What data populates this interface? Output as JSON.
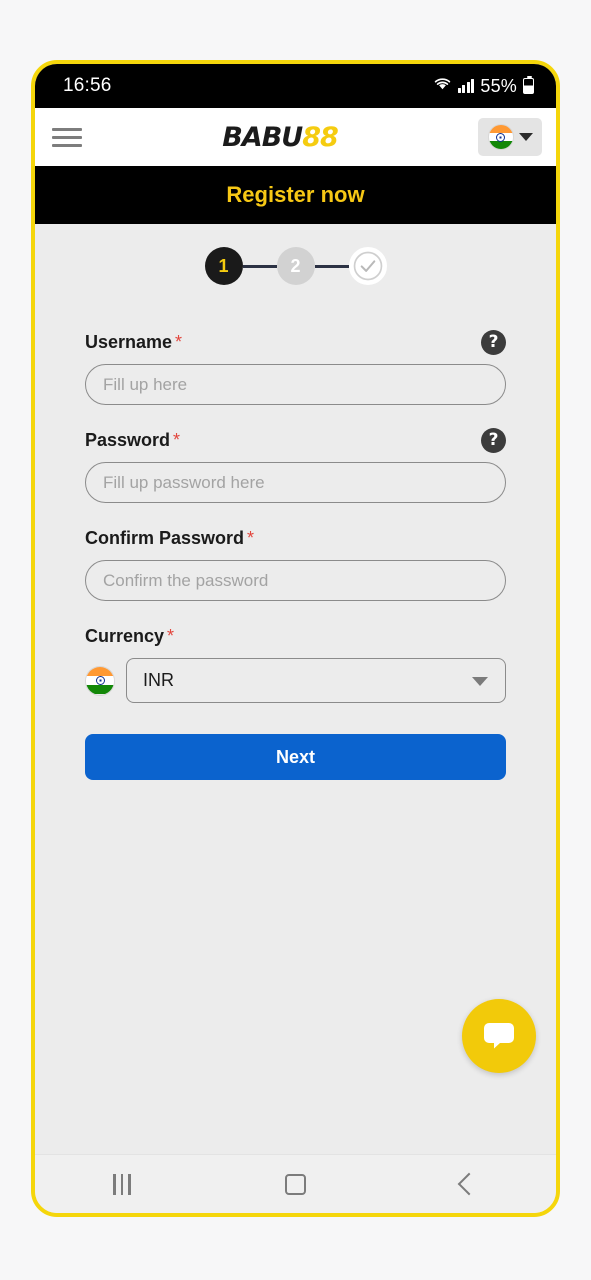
{
  "status_bar": {
    "time": "16:56",
    "battery_text": "55%",
    "wifi_icon": "wifi-icon",
    "signal_icon": "cellular-signal-icon",
    "battery_icon": "battery-icon"
  },
  "header": {
    "menu_icon": "hamburger-menu-icon",
    "logo_part1": "BABU",
    "logo_part2": "88",
    "language_flag": "india-flag-icon",
    "language_caret": "chevron-down-icon"
  },
  "banner": {
    "title": "Register now"
  },
  "stepper": {
    "steps": [
      {
        "label": "1",
        "state": "active"
      },
      {
        "label": "2",
        "state": "idle"
      },
      {
        "label": "",
        "state": "done",
        "icon": "check-circle-icon"
      }
    ]
  },
  "form": {
    "username": {
      "label": "Username",
      "required_mark": "*",
      "placeholder": "Fill up here",
      "value": "",
      "help_icon": "question-mark-icon"
    },
    "password": {
      "label": "Password",
      "required_mark": "*",
      "placeholder": "Fill up password here",
      "value": "",
      "help_icon": "question-mark-icon"
    },
    "confirm_password": {
      "label": "Confirm Password",
      "required_mark": "*",
      "placeholder": "Confirm the password",
      "value": ""
    },
    "currency": {
      "label": "Currency",
      "required_mark": "*",
      "selected": "INR",
      "flag_icon": "india-flag-icon",
      "caret_icon": "chevron-down-icon",
      "options": [
        "INR"
      ]
    },
    "submit_label": "Next"
  },
  "chat": {
    "icon": "chat-bubble-icon"
  },
  "nav_bar": {
    "recents_icon": "recents-icon",
    "home_icon": "home-icon",
    "back_icon": "back-icon"
  },
  "colors": {
    "frame_border": "#f5d60b",
    "banner_bg": "#000000",
    "banner_text": "#f7c815",
    "accent_blue": "#0b63ce",
    "chat_yellow": "#f2ca0a",
    "required_red": "#e2453c",
    "page_bg": "#ececec"
  }
}
